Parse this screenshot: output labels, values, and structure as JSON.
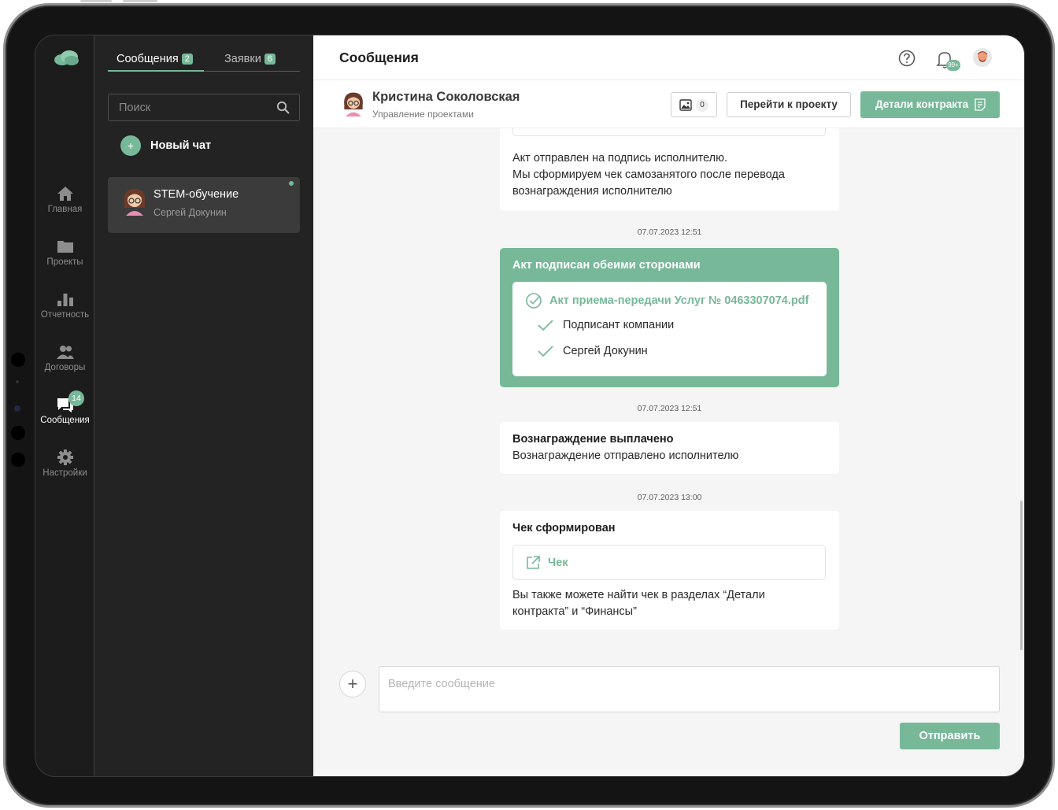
{
  "rail": {
    "items": [
      {
        "label": "Главная",
        "icon": "home-icon"
      },
      {
        "label": "Проекты",
        "icon": "folder-icon"
      },
      {
        "label": "Отчетность",
        "icon": "bar-chart-icon"
      },
      {
        "label": "Договоры",
        "icon": "users-icon"
      },
      {
        "label": "Сообщения",
        "icon": "chat-icon",
        "badge": "14",
        "active": true
      },
      {
        "label": "Настройки",
        "icon": "gear-icon"
      }
    ]
  },
  "list": {
    "tabs": [
      {
        "label": "Сообщения",
        "count": "2",
        "active": true
      },
      {
        "label": "Заявки",
        "count": "6",
        "active": false
      }
    ],
    "search_placeholder": "Поиск",
    "new_chat_label": "Новый чат",
    "chats": [
      {
        "name": "STEM-обучение",
        "subtitle": "Сергей Докунин",
        "unread": true
      }
    ]
  },
  "header": {
    "title": "Сообщения",
    "bell_badge": "99+"
  },
  "chat": {
    "name": "Кристина Соколовская",
    "role": "Управление проектами",
    "images_count": "0",
    "go_to_project_label": "Перейти к проекту",
    "contract_details_label": "Детали контракта"
  },
  "messages": {
    "m1": {
      "lines": [
        "Акт отправлен на подпись исполнителю.",
        "Мы сформируем чек самозанятого после перевода",
        "вознаграждения исполнителю"
      ]
    },
    "m2": {
      "time": "07.07.2023 12:51",
      "title": "Акт подписан обеими сторонами",
      "file": "Акт приема-передачи Услуг № 0463307074.pdf",
      "signers": [
        "Подписант компании",
        "Сергей Докунин"
      ]
    },
    "m3": {
      "time": "07.07.2023 12:51",
      "title": "Вознаграждение выплачено",
      "text": "Вознаграждение отправлено исполнителю"
    },
    "m4": {
      "time": "07.07.2023 13:00",
      "title": "Чек сформирован",
      "link_label": "Чек",
      "lines": [
        "Вы также можете найти чек в разделах “Детали",
        "контракта” и “Финансы”"
      ]
    }
  },
  "composer": {
    "placeholder": "Введите сообщение",
    "send_label": "Отправить"
  },
  "colors": {
    "accent": "#77b899",
    "sidebar_bg": "#1c1c1c",
    "panel_bg": "#232323",
    "selected_chat_bg": "#3b3b3b",
    "main_bg": "#f5f5f5"
  }
}
